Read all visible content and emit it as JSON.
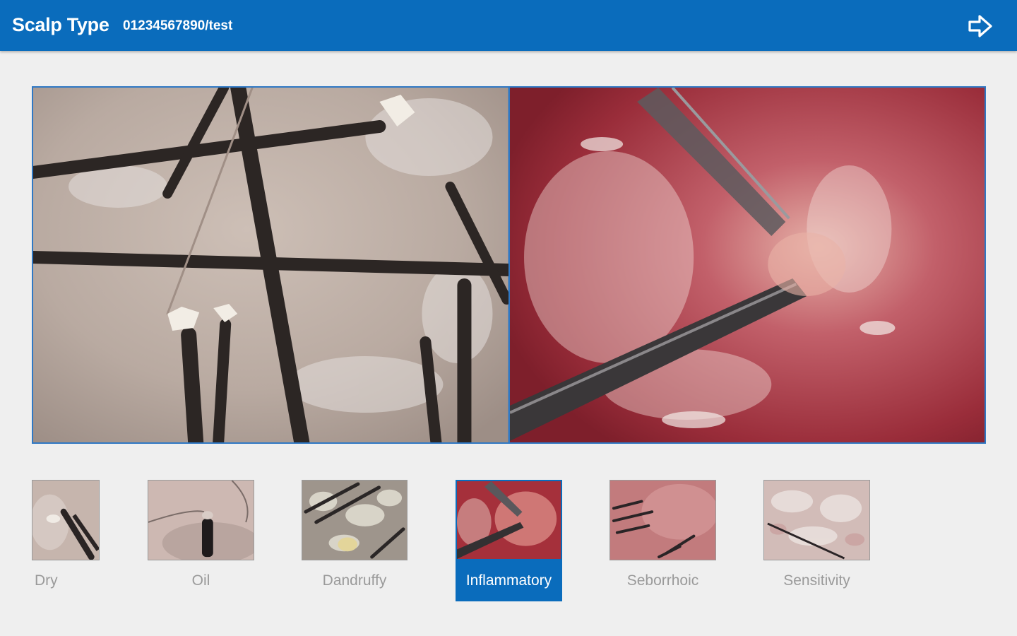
{
  "header": {
    "title": "Scalp Type",
    "subtitle": "01234567890/test",
    "next_icon": "arrow-right-icon"
  },
  "viewer": {
    "left_image": "dry-scalp-magnified",
    "right_image": "inflammatory-scalp-magnified"
  },
  "scalp_types": [
    {
      "label": "Dry",
      "selected": false
    },
    {
      "label": "Oil",
      "selected": false
    },
    {
      "label": "Dandruffy",
      "selected": false
    },
    {
      "label": "Inflammatory",
      "selected": true
    },
    {
      "label": "Seborrhoic",
      "selected": false
    },
    {
      "label": "Sensitivity",
      "selected": false
    }
  ],
  "colors": {
    "accent": "#0a6cbc",
    "frame": "#2f78c4",
    "background": "#efefef",
    "label_inactive": "#9a9a9a"
  }
}
